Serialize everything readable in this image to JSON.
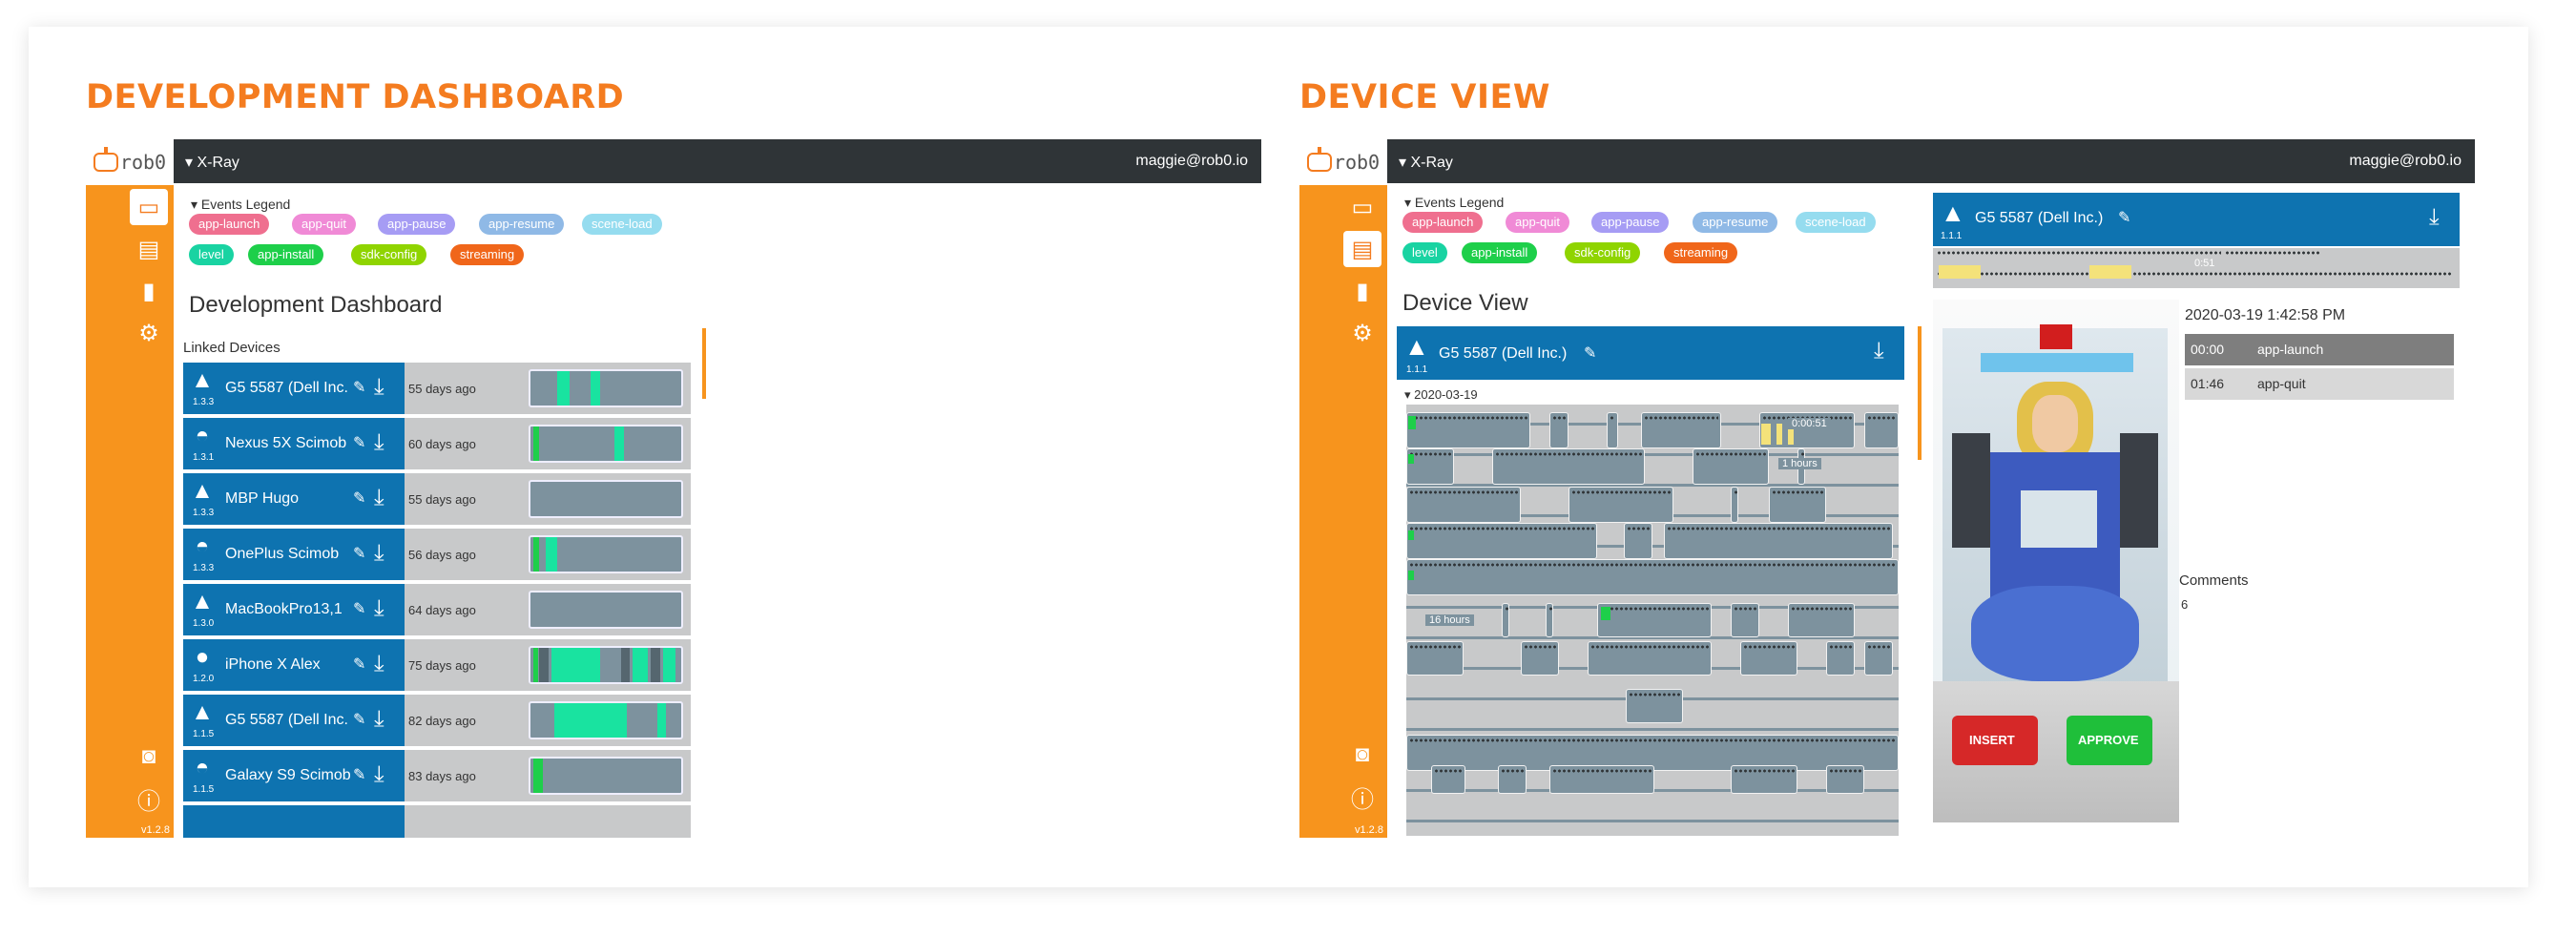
{
  "panels": {
    "left_title": "DEVELOPMENT DASHBOARD",
    "right_title": "DEVICE VIEW"
  },
  "app": {
    "logo_text": "rob0",
    "version": "v1.2.8",
    "topbar_title": "▾ X-Ray",
    "user": "maggie@rob0.io"
  },
  "legend": {
    "heading": "▾ Events Legend",
    "events": [
      {
        "label": "app-launch",
        "color": "#ef6f8f"
      },
      {
        "label": "app-quit",
        "color": "#f08ad6"
      },
      {
        "label": "app-pause",
        "color": "#a69cf4"
      },
      {
        "label": "app-resume",
        "color": "#8fb9e6"
      },
      {
        "label": "scene-load",
        "color": "#95dcef"
      },
      {
        "label": "level",
        "color": "#19d3a2"
      },
      {
        "label": "app-install",
        "color": "#1ecf4a"
      },
      {
        "label": "sdk-config",
        "color": "#8fd400"
      },
      {
        "label": "streaming",
        "color": "#f0661a"
      }
    ]
  },
  "dashboard": {
    "title": "Development Dashboard",
    "linked_devices_label": "Linked Devices",
    "devices": [
      {
        "name": "G5 5587 (Dell Inc.",
        "version": "1.3.3",
        "ago": "55 days ago",
        "os": "unity"
      },
      {
        "name": "Nexus 5X Scimob",
        "version": "1.3.1",
        "ago": "60 days ago",
        "os": "android"
      },
      {
        "name": "MBP Hugo",
        "version": "1.3.3",
        "ago": "55 days ago",
        "os": "unity"
      },
      {
        "name": "OnePlus Scimob",
        "version": "1.3.3",
        "ago": "56 days ago",
        "os": "android"
      },
      {
        "name": "MacBookPro13,1",
        "version": "1.3.0",
        "ago": "64 days ago",
        "os": "unity"
      },
      {
        "name": "iPhone X Alex",
        "version": "1.2.0",
        "ago": "75 days ago",
        "os": "apple"
      },
      {
        "name": "G5 5587 (Dell Inc.",
        "version": "1.1.5",
        "ago": "82 days ago",
        "os": "unity"
      },
      {
        "name": "Galaxy S9 Scimob",
        "version": "1.1.5",
        "ago": "83 days ago",
        "os": "android"
      }
    ]
  },
  "device_view": {
    "title": "Device View",
    "device_name": "G5 5587 (Dell Inc.)",
    "device_version": "1.1.1",
    "date_label": "▾ 2020-03-19",
    "timeline_labels": [
      "0:00:51",
      "1 hours",
      "16 hours"
    ],
    "mini_timeline_label": "0:51",
    "screenshot_time": "2020-03-19 1:42:58 PM",
    "log": [
      {
        "time": "00:00",
        "event": "app-launch"
      },
      {
        "time": "01:46",
        "event": "app-quit"
      }
    ],
    "comments_label": "Comments",
    "comments_count": "6",
    "game_buttons": [
      "INSERT",
      "APPROVE"
    ]
  }
}
